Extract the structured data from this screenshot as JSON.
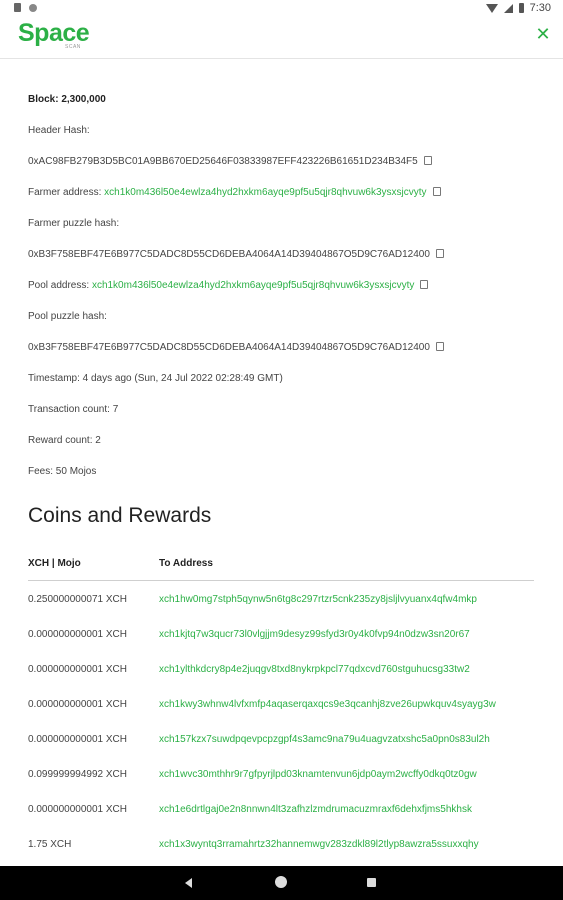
{
  "status": {
    "time": "7:30"
  },
  "app": {
    "logo": "Space",
    "logo_sub": "SCAN",
    "close_icon": "close-icon"
  },
  "block": {
    "block_label": "Block:",
    "block_value": "2,300,000",
    "header_hash_label": "Header Hash:",
    "header_hash": "0xAC98FB279B3D5BC01A9BB670ED25646F03833987EFF423226B61651D234B34F5",
    "farmer_address_label": "Farmer address:",
    "farmer_address": "xch1k0m436l50e4ewlza4hyd2hxkm6ayqe9pf5u5qjr8qhvuw6k3ysxsjcvyty",
    "farmer_puzzle_hash_label": "Farmer puzzle hash:",
    "farmer_puzzle_hash": "0xB3F758EBF47E6B977C5DADC8D55CD6DEBA4064A14D39404867O5D9C76AD12400",
    "pool_address_label": "Pool address:",
    "pool_address": "xch1k0m436l50e4ewlza4hyd2hxkm6ayqe9pf5u5qjr8qhvuw6k3ysxsjcvyty",
    "pool_puzzle_hash_label": "Pool puzzle hash:",
    "pool_puzzle_hash": "0xB3F758EBF47E6B977C5DADC8D55CD6DEBA4064A14D39404867O5D9C76AD12400",
    "timestamp_label": "Timestamp:",
    "timestamp": "4 days ago (Sun, 24 Jul 2022 02:28:49 GMT)",
    "tx_count_label": "Transaction count:",
    "tx_count": "7",
    "reward_count_label": "Reward count:",
    "reward_count": "2",
    "fees_label": "Fees:",
    "fees": "50 Mojos"
  },
  "coins": {
    "title": "Coins and Rewards",
    "col_amount": "XCH | Mojo",
    "col_address": "To Address",
    "rows": [
      {
        "amount": "0.250000000071 XCH",
        "address": "xch1hw0mg7stph5qynw5n6tg8c297rtzr5cnk235zy8jsljlvyuanx4qfw4mkp"
      },
      {
        "amount": "0.000000000001 XCH",
        "address": "xch1kjtq7w3qucr73l0vlgjjm9desyz99sfyd3r0y4k0fvp94n0dzw3sn20r67"
      },
      {
        "amount": "0.000000000001 XCH",
        "address": "xch1ylthkdcry8p4e2juqgv8txd8nykrpkpcl77qdxcvd760stguhucsg33tw2"
      },
      {
        "amount": "0.000000000001 XCH",
        "address": "xch1kwy3whnw4lvfxmfp4aqaserqaxqcs9e3qcanhj8zve26upwkquv4syayg3w"
      },
      {
        "amount": "0.000000000001 XCH",
        "address": "xch157kzx7suwdpqevpcpzgpf4s3amc9na79u4uagvzatxshc5a0pn0s83ul2h"
      },
      {
        "amount": "0.099999994992 XCH",
        "address": "xch1wvc30mthhr9r7gfpyrjlpd03knamtenvun6jdp0aym2wcffy0dkq0tz0gw"
      },
      {
        "amount": "0.000000000001 XCH",
        "address": "xch1e6drtlgaj0e2n8nnwn4lt3zafhzlzmdrumacuzmraxf6dehxfjms5hkhsk"
      },
      {
        "amount": "1.75 XCH",
        "address": "xch1x3wyntq3rramahrtz32hannemwgv283zdkl89l2tlyp8awzra5ssuxxqhy"
      }
    ]
  }
}
